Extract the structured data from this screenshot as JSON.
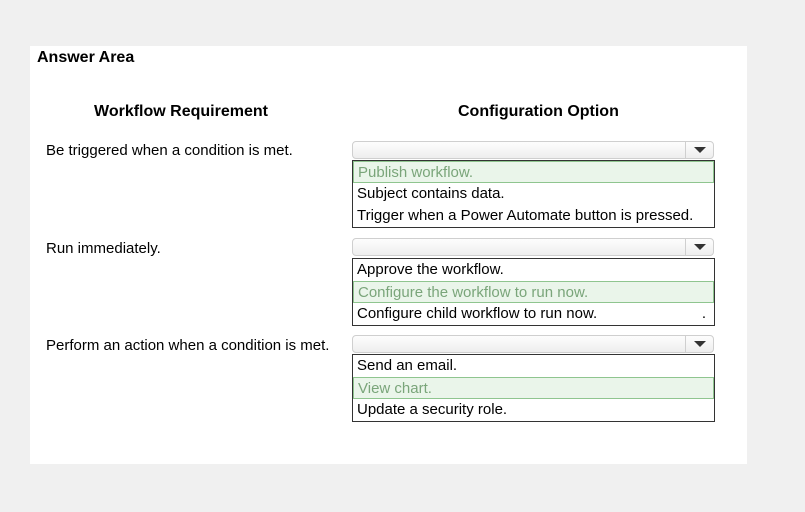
{
  "answer_area": {
    "title": "Answer Area"
  },
  "headers": {
    "requirement": "Workflow Requirement",
    "option": "Configuration Option"
  },
  "rows": [
    {
      "requirement": "Be triggered when a condition is met.",
      "options": [
        {
          "label": "Publish workflow.",
          "selected": true
        },
        {
          "label": "Subject contains data.",
          "selected": false
        },
        {
          "label": "Trigger when a Power Automate button is pressed.",
          "selected": false
        }
      ]
    },
    {
      "requirement": "Run immediately.",
      "options": [
        {
          "label": "Approve the workflow.",
          "selected": false
        },
        {
          "label": "Configure the workflow to run now.",
          "selected": true
        },
        {
          "label": "Configure child workflow to run now.",
          "selected": false
        }
      ],
      "trailing_mark": "."
    },
    {
      "requirement": "Perform an action when a condition is met.",
      "options": [
        {
          "label": "Send an email.",
          "selected": false
        },
        {
          "label": "View chart.",
          "selected": true
        },
        {
          "label": "Update a security role.",
          "selected": false
        }
      ]
    }
  ],
  "icons": {
    "dropdown": "chevron-down-icon"
  },
  "colors": {
    "selected_bg": "#eaf5ea",
    "selected_border": "#8fc58f",
    "selected_text": "#7aa57a"
  }
}
